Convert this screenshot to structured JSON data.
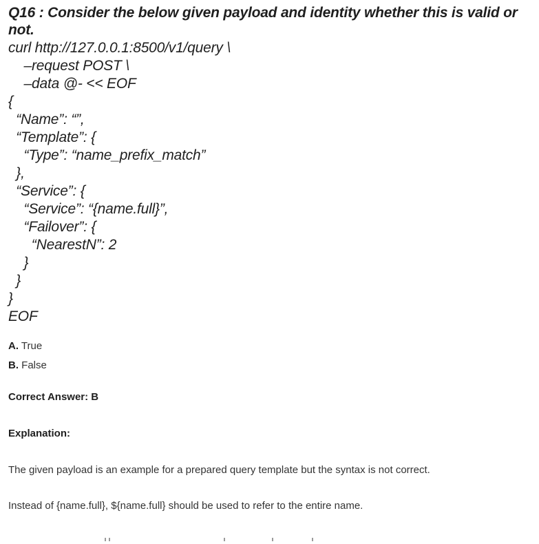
{
  "question": {
    "title": "Q16 : Consider the below given payload and identity whether this is valid or not."
  },
  "code_lines": [
    "curl http://127.0.0.1:8500/v1/query \\",
    "    –request POST \\",
    "    –data @- << EOF",
    "{",
    "  “Name”: “”,",
    "  “Template”: {",
    "    “Type”: “name_prefix_match”",
    "  },",
    "  “Service”: {",
    "    “Service”: “{name.full}”,",
    "    “Failover”: {",
    "      “NearestN”: 2",
    "    }",
    "  }",
    "}",
    "EOF"
  ],
  "options": [
    {
      "key": "A.",
      "text": " True"
    },
    {
      "key": "B.",
      "text": " False"
    }
  ],
  "answer": {
    "label": "Correct Answer: B"
  },
  "explanation": {
    "heading": "Explanation:",
    "paragraphs": [
      "The given payload is an example for a prepared query template but the syntax is not correct.",
      "Instead of {name.full}, ${name.full} should be used to refer to the entire name."
    ]
  }
}
